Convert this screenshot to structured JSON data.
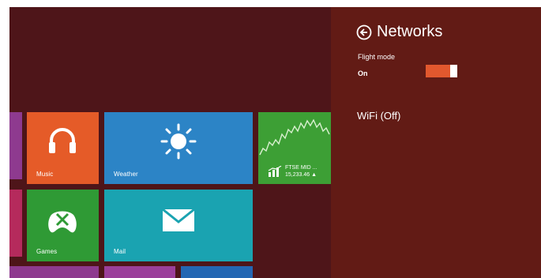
{
  "start_screen": {
    "tiles": [
      {
        "label": "Music",
        "icon": "headphones-icon",
        "color": "#e55b28"
      },
      {
        "label": "Weather",
        "icon": "sun-icon",
        "color": "#2c84c6"
      },
      {
        "label": "",
        "icon": "stock-chart-icon",
        "color": "#3d9f35",
        "finance": {
          "name": "FTSE MID ...",
          "value": "15,233.46 ▲"
        }
      },
      {
        "label": "Games",
        "icon": "xbox-controller-icon",
        "color": "#2f9a35"
      },
      {
        "label": "Mail",
        "icon": "mail-envelope-icon",
        "color": "#1aa3b1"
      }
    ]
  },
  "networks_pane": {
    "title": "Networks",
    "flight_mode_label": "Flight mode",
    "flight_mode_state": "On",
    "flight_mode_on": true,
    "wifi_label": "WiFi (Off)"
  },
  "colors": {
    "start_background": "#4e1519",
    "charms_background": "#621b15",
    "toggle_accent": "#e2582e"
  }
}
